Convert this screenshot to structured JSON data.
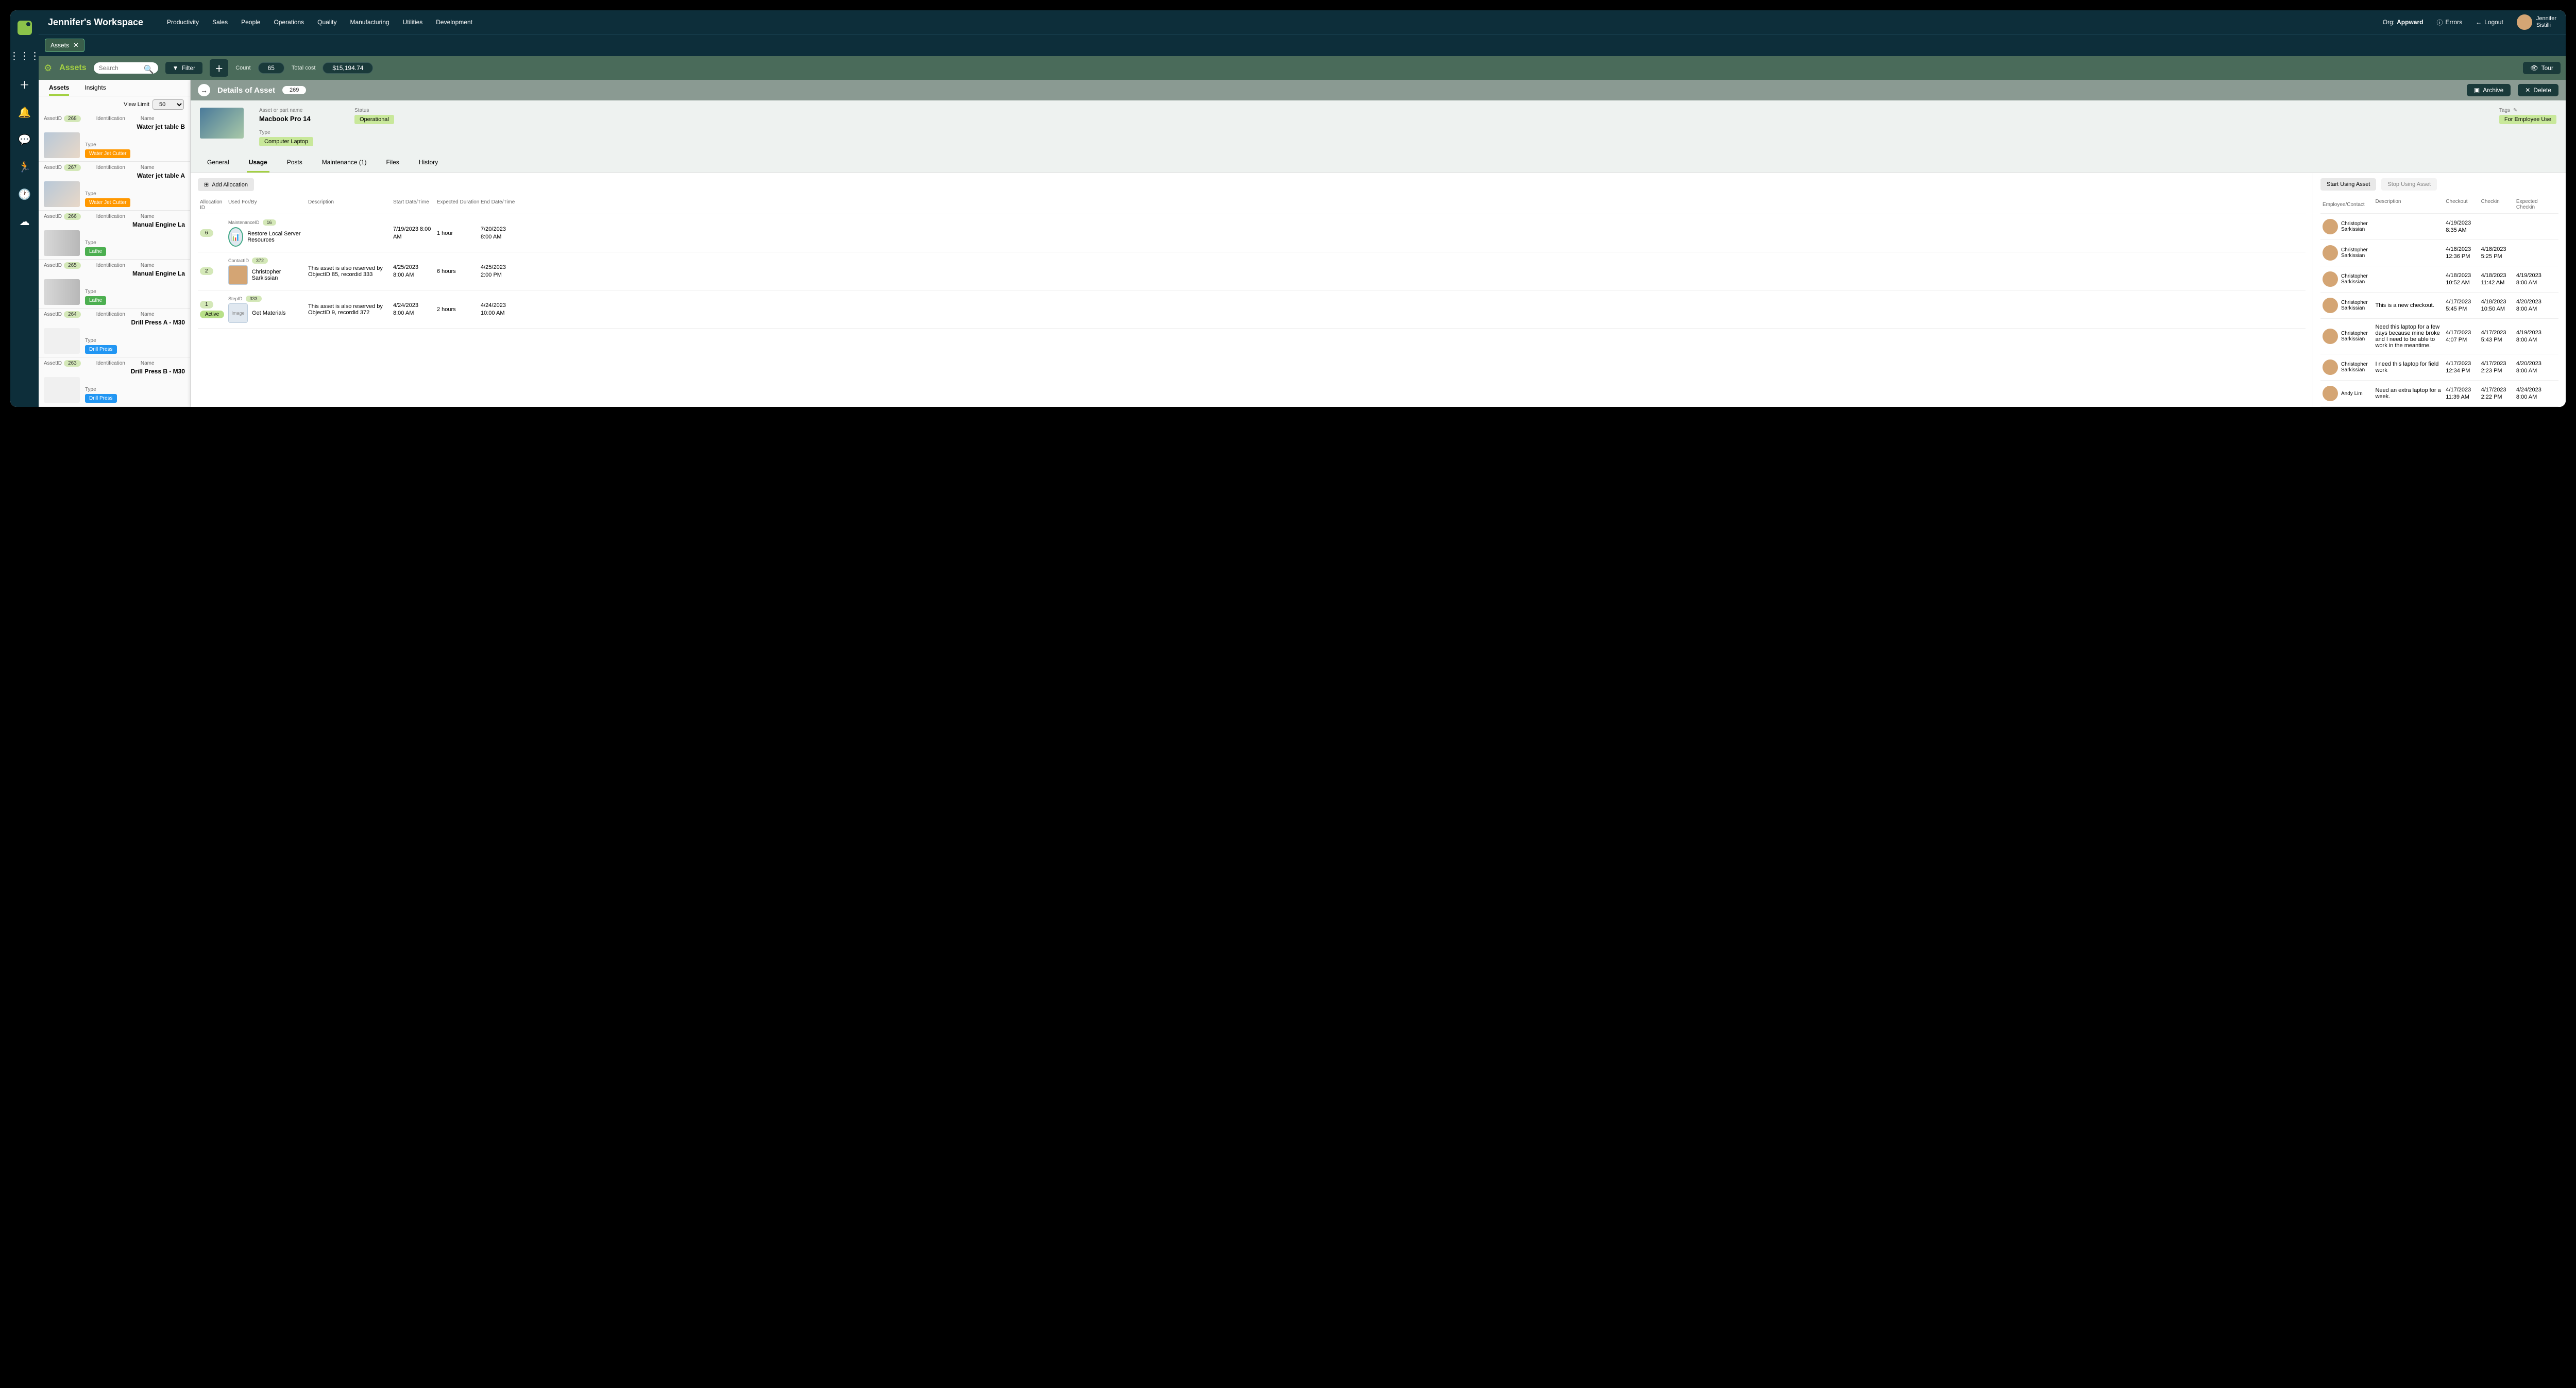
{
  "workspace_title": "Jennifer's Workspace",
  "nav": [
    "Productivity",
    "Sales",
    "People",
    "Operations",
    "Quality",
    "Manufacturing",
    "Utilities",
    "Development"
  ],
  "org_label": "Org:",
  "org_value": "Appward",
  "errors": "Errors",
  "logout": "Logout",
  "user_first": "Jennifer",
  "user_last": "Sistilli",
  "chip_label": "Assets",
  "toolbar_title": "Assets",
  "search_placeholder": "Search",
  "filter_label": "Filter",
  "count_label": "Count",
  "count_value": "65",
  "totalcost_label": "Total cost",
  "totalcost_value": "$15,194.74",
  "tour_label": "Tour",
  "lp_tabs": {
    "assets": "Assets",
    "insights": "Insights"
  },
  "view_limit_label": "View Limit",
  "view_limit_value": "50",
  "asset_labels": {
    "assetid": "AssetID",
    "identification": "Identification",
    "name": "Name",
    "type": "Type"
  },
  "assets": [
    {
      "id": "268",
      "name": "Water jet table B",
      "type": "Water Jet Cutter",
      "badge": "orange",
      "img": "jet"
    },
    {
      "id": "267",
      "name": "Water jet table A",
      "type": "Water Jet Cutter",
      "badge": "orange",
      "img": "jet"
    },
    {
      "id": "266",
      "name": "Manual Engine La",
      "type": "Lathe",
      "badge": "green",
      "img": "lathe"
    },
    {
      "id": "265",
      "name": "Manual Engine La",
      "type": "Lathe",
      "badge": "green",
      "img": "lathe"
    },
    {
      "id": "264",
      "name": "Drill Press A - M30",
      "type": "Drill Press",
      "badge": "blue",
      "img": "drill"
    },
    {
      "id": "263",
      "name": "Drill Press B - M30",
      "type": "Drill Press",
      "badge": "blue",
      "img": "drill"
    }
  ],
  "detail": {
    "title": "Details of Asset",
    "id": "269",
    "archive": "Archive",
    "delete": "Delete",
    "name_label": "Asset or part name",
    "name": "Macbook Pro 14",
    "type_label": "Type",
    "type": "Computer Laptop",
    "status_label": "Status",
    "status": "Operational",
    "tags_label": "Tags",
    "tag": "For Employee Use",
    "tabs": {
      "general": "General",
      "usage": "Usage",
      "posts": "Posts",
      "maintenance": "Maintenance (1)",
      "files": "Files",
      "history": "History"
    }
  },
  "add_allocation": "Add Allocation",
  "start_using": "Start Using Asset",
  "stop_using": "Stop Using Asset",
  "alloc_headers": {
    "aid": "Allocation ID",
    "used": "Used For/By",
    "desc": "Description",
    "start": "Start Date/Time",
    "dur": "Expected Duration",
    "end": "End Date/Time"
  },
  "allocations": [
    {
      "aid": "6",
      "ref_lbl": "MaintenanceID",
      "ref_id": "16",
      "thumb": "icon",
      "text": "Restore Local Server Resources",
      "desc": "",
      "start1": "7/19/2023 8:00",
      "start2": "AM",
      "dur": "1 hour",
      "end1": "7/20/2023",
      "end2": "8:00 AM"
    },
    {
      "aid": "2",
      "ref_lbl": "ContactID",
      "ref_id": "372",
      "thumb": "person",
      "text": "Christopher Sarkissian",
      "desc": "This asset is also reserved by ObjectID  85, recordid 333",
      "start1": "4/25/2023",
      "start2": "8:00 AM",
      "dur": "6 hours",
      "end1": "4/25/2023",
      "end2": "2:00 PM"
    },
    {
      "aid": "1",
      "extra": "Active",
      "ref_lbl": "StepID",
      "ref_id": "333",
      "thumb": "img",
      "text": "Get Materials",
      "desc": "This asset is also reserved by ObjectID  9, recordid 372",
      "start1": "4/24/2023",
      "start2": "8:00 AM",
      "dur": "2 hours",
      "end1": "4/24/2023",
      "end2": "10:00 AM"
    }
  ],
  "usage_headers": {
    "emp": "Employee/Contact",
    "desc": "Description",
    "co": "Checkout",
    "ci": "Checkin",
    "ec": "Expected Checkin"
  },
  "usage": [
    {
      "name": "Christopher Sarkissian",
      "desc": "",
      "co1": "4/19/2023",
      "co2": "8:35 AM",
      "ci1": "",
      "ci2": "",
      "ec1": "",
      "ec2": ""
    },
    {
      "name": "Christopher Sarkissian",
      "desc": "",
      "co1": "4/18/2023",
      "co2": "12:36 PM",
      "ci1": "4/18/2023",
      "ci2": "5:25 PM",
      "ec1": "",
      "ec2": ""
    },
    {
      "name": "Christopher Sarkissian",
      "desc": "",
      "co1": "4/18/2023",
      "co2": "10:52 AM",
      "ci1": "4/18/2023",
      "ci2": "11:42 AM",
      "ec1": "4/19/2023",
      "ec2": "8:00 AM"
    },
    {
      "name": "Christopher Sarkissian",
      "desc": "This is a new checkout.",
      "co1": "4/17/2023",
      "co2": "5:45 PM",
      "ci1": "4/18/2023",
      "ci2": "10:50 AM",
      "ec1": "4/20/2023",
      "ec2": "8:00 AM"
    },
    {
      "name": "Christopher Sarkissian",
      "desc": "Need this laptop for a few days because mine broke and I need to be able to work in the meantime.",
      "co1": "4/17/2023",
      "co2": "4:07 PM",
      "ci1": "4/17/2023",
      "ci2": "5:43 PM",
      "ec1": "4/19/2023",
      "ec2": "8:00 AM"
    },
    {
      "name": "Christopher Sarkissian",
      "desc": "I need this laptop for field work",
      "co1": "4/17/2023",
      "co2": "12:34 PM",
      "ci1": "4/17/2023",
      "ci2": "2:23 PM",
      "ec1": "4/20/2023",
      "ec2": "8:00 AM"
    },
    {
      "name": "Andy Lim",
      "desc": "Need an extra laptop for a week.",
      "co1": "4/17/2023",
      "co2": "11:39 AM",
      "ci1": "4/17/2023",
      "ci2": "2:22 PM",
      "ec1": "4/24/2023",
      "ec2": "8:00 AM"
    }
  ]
}
